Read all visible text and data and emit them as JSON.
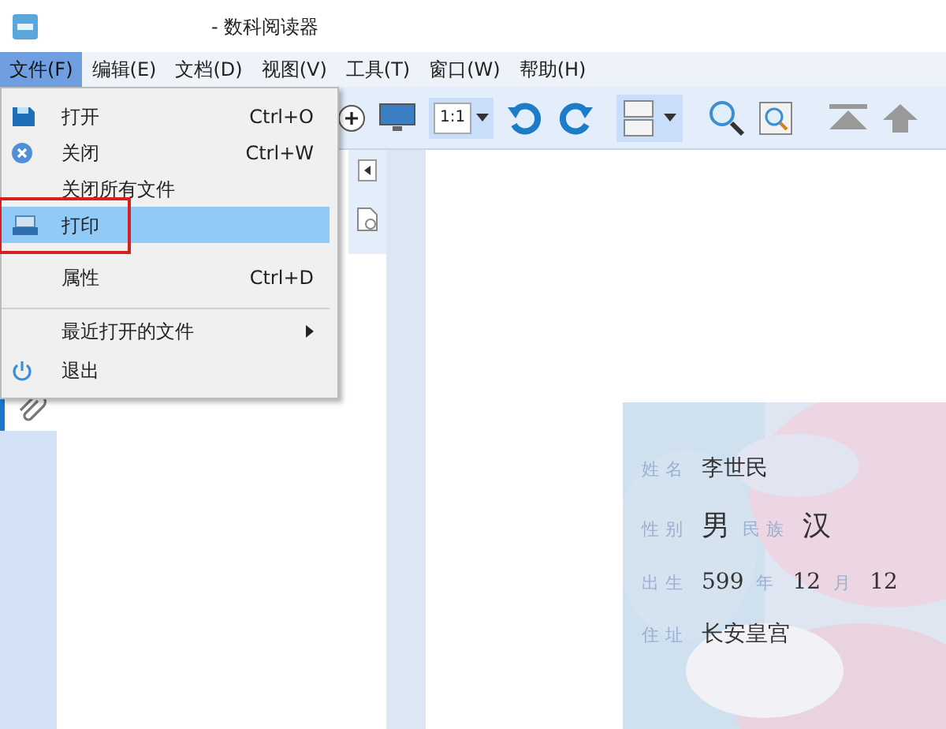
{
  "window": {
    "title": "- 数科阅读器"
  },
  "menu_bar": [
    {
      "label": "文件(F)",
      "selected": true
    },
    {
      "label": "编辑(E)",
      "selected": false
    },
    {
      "label": "文档(D)",
      "selected": false
    },
    {
      "label": "视图(V)",
      "selected": false
    },
    {
      "label": "工具(T)",
      "selected": false
    },
    {
      "label": "窗口(W)",
      "selected": false
    },
    {
      "label": "帮助(H)",
      "selected": false
    }
  ],
  "file_menu": [
    {
      "label": "打开",
      "shortcut": "Ctrl+O",
      "highlighted": false,
      "annotated": false,
      "separator_before": false,
      "submenu": false
    },
    {
      "label": "关闭",
      "shortcut": "Ctrl+W",
      "highlighted": false,
      "annotated": false,
      "separator_before": false,
      "submenu": false
    },
    {
      "label": "关闭所有文件",
      "highlighted": false,
      "annotated": false,
      "separator_before": false,
      "submenu": false
    },
    {
      "label": "打印",
      "highlighted": true,
      "annotated": true,
      "separator_before": false,
      "submenu": false
    },
    {
      "label": "属性",
      "shortcut": "Ctrl+D",
      "highlighted": false,
      "annotated": false,
      "separator_before": false,
      "submenu": false
    },
    {
      "label": "最近打开的文件",
      "highlighted": false,
      "annotated": false,
      "separator_before": true,
      "submenu": true
    },
    {
      "label": "退出",
      "highlighted": false,
      "annotated": false,
      "separator_before": false,
      "submenu": false
    }
  ],
  "toolbar": {
    "zoom_button": "1:1"
  },
  "sidebar": {
    "tabs": [
      {
        "selected": true
      }
    ]
  },
  "id_card": {
    "fields": [
      {
        "parts": [
          {
            "kind": "label",
            "text": "姓名"
          },
          {
            "kind": "value",
            "text": "李世民"
          }
        ]
      },
      {
        "parts": [
          {
            "kind": "label",
            "text": "性别"
          },
          {
            "kind": "big",
            "text": "男"
          },
          {
            "kind": "label",
            "text": "民族"
          },
          {
            "kind": "big",
            "text": "汉"
          }
        ]
      },
      {
        "parts": [
          {
            "kind": "label",
            "text": "出生"
          },
          {
            "kind": "value",
            "text": "599"
          },
          {
            "kind": "label",
            "text": "年"
          },
          {
            "kind": "value",
            "text": "12"
          },
          {
            "kind": "label",
            "text": "月"
          },
          {
            "kind": "value",
            "text": "12"
          }
        ]
      },
      {
        "parts": [
          {
            "kind": "label",
            "text": "住址"
          },
          {
            "kind": "value",
            "text": "长安皇宫"
          }
        ]
      }
    ]
  }
}
